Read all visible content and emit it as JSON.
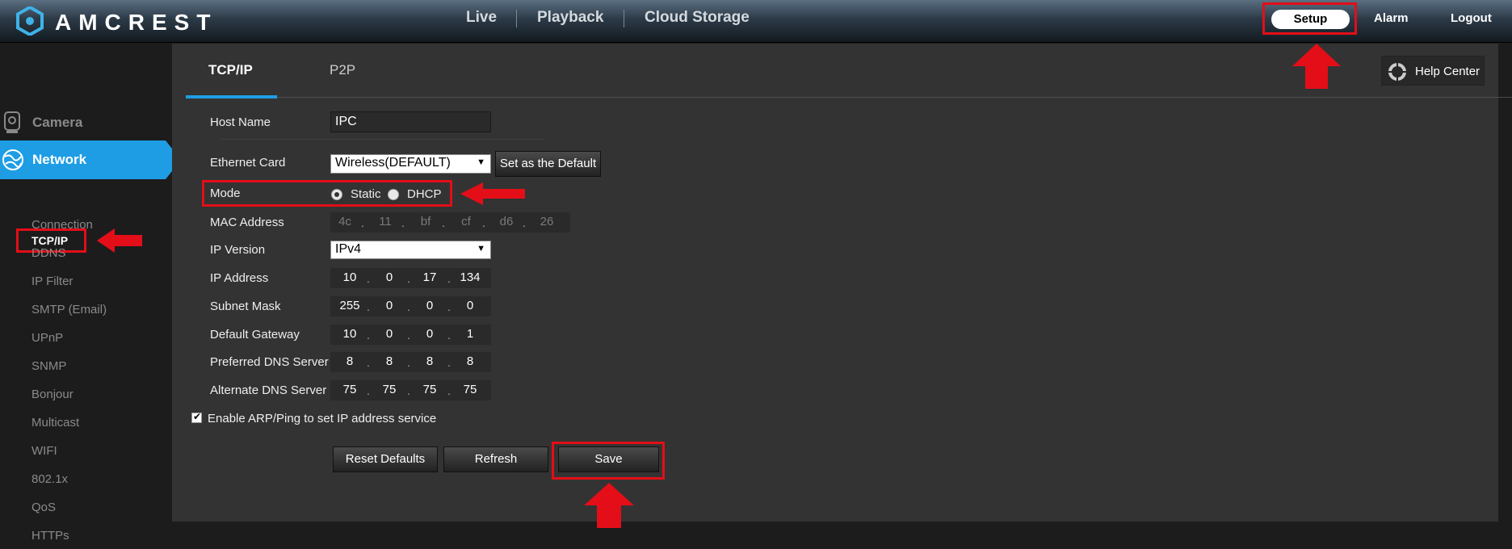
{
  "brand": {
    "name": "AMCREST"
  },
  "topnav": {
    "live": "Live",
    "playback": "Playback",
    "cloud_storage": "Cloud Storage",
    "setup": "Setup",
    "alarm": "Alarm",
    "logout": "Logout"
  },
  "sidebar": {
    "camera": "Camera",
    "network": "Network",
    "items": [
      "TCP/IP",
      "Connection",
      "DDNS",
      "IP Filter",
      "SMTP (Email)",
      "UPnP",
      "SNMP",
      "Bonjour",
      "Multicast",
      "WIFI",
      "802.1x",
      "QoS",
      "HTTPs"
    ]
  },
  "tabs": {
    "tcpip": "TCP/IP",
    "p2p": "P2P"
  },
  "help_center": "Help Center",
  "form": {
    "host_name": {
      "label": "Host Name",
      "value": "IPC"
    },
    "ethernet_card": {
      "label": "Ethernet Card",
      "value": "Wireless(DEFAULT)",
      "set_default": "Set as the Default"
    },
    "mode": {
      "label": "Mode",
      "static": "Static",
      "dhcp": "DHCP",
      "selected": "Static"
    },
    "mac_address": {
      "label": "MAC Address",
      "octets": [
        "4c",
        "11",
        "bf",
        "cf",
        "d6",
        "26"
      ]
    },
    "ip_version": {
      "label": "IP Version",
      "value": "IPv4"
    },
    "ip_address": {
      "label": "IP Address",
      "octets": [
        "10",
        "0",
        "17",
        "134"
      ]
    },
    "subnet_mask": {
      "label": "Subnet Mask",
      "octets": [
        "255",
        "0",
        "0",
        "0"
      ]
    },
    "default_gateway": {
      "label": "Default Gateway",
      "octets": [
        "10",
        "0",
        "0",
        "1"
      ]
    },
    "preferred_dns": {
      "label": "Preferred DNS Server",
      "octets": [
        "8",
        "8",
        "8",
        "8"
      ]
    },
    "alternate_dns": {
      "label": "Alternate DNS Server",
      "octets": [
        "75",
        "75",
        "75",
        "75"
      ]
    },
    "arp_ping": {
      "label": "Enable ARP/Ping to set IP address service",
      "checked": true
    }
  },
  "buttons": {
    "reset_defaults": "Reset Defaults",
    "refresh": "Refresh",
    "save": "Save"
  },
  "colors": {
    "accent": "#1e9de4",
    "highlight": "#e30e18",
    "panel": "#333333"
  }
}
